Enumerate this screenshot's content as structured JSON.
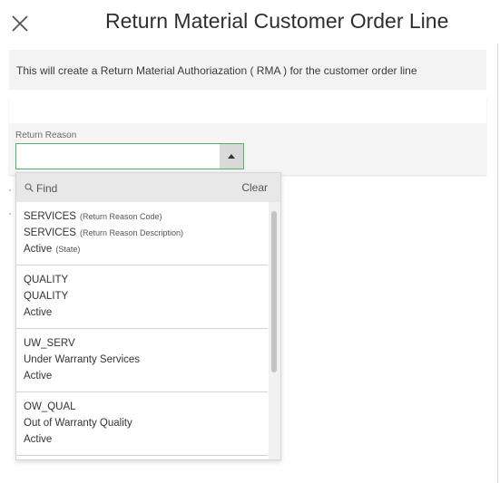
{
  "dialog": {
    "title": "Return Material Customer Order Line",
    "info_text": "This will create a Return Material Authoriazation ( RMA ) for the customer order line"
  },
  "form": {
    "return_reason_label": "Return Reason",
    "return_reason_value": ""
  },
  "dropdown": {
    "search_placeholder": "Find",
    "clear_label": "Clear",
    "options": [
      {
        "code": "SERVICES",
        "code_hint": "(Return Reason Code)",
        "description": "SERVICES",
        "description_hint": "(Return Reason Description)",
        "state": "Active",
        "state_hint": "(State)"
      },
      {
        "code": "QUALITY",
        "description": "QUALITY",
        "state": "Active"
      },
      {
        "code": "UW_SERV",
        "description": "Under Warranty Services",
        "state": "Active"
      },
      {
        "code": "OW_QUAL",
        "description": "Out of Warranty Quality",
        "state": "Active"
      }
    ]
  },
  "icons": {
    "close": "close-icon",
    "dropdown": "triangle-up-icon",
    "search": "search-icon"
  },
  "colors": {
    "focus_border": "#55b06a",
    "info_bg": "#f3f3f3"
  }
}
